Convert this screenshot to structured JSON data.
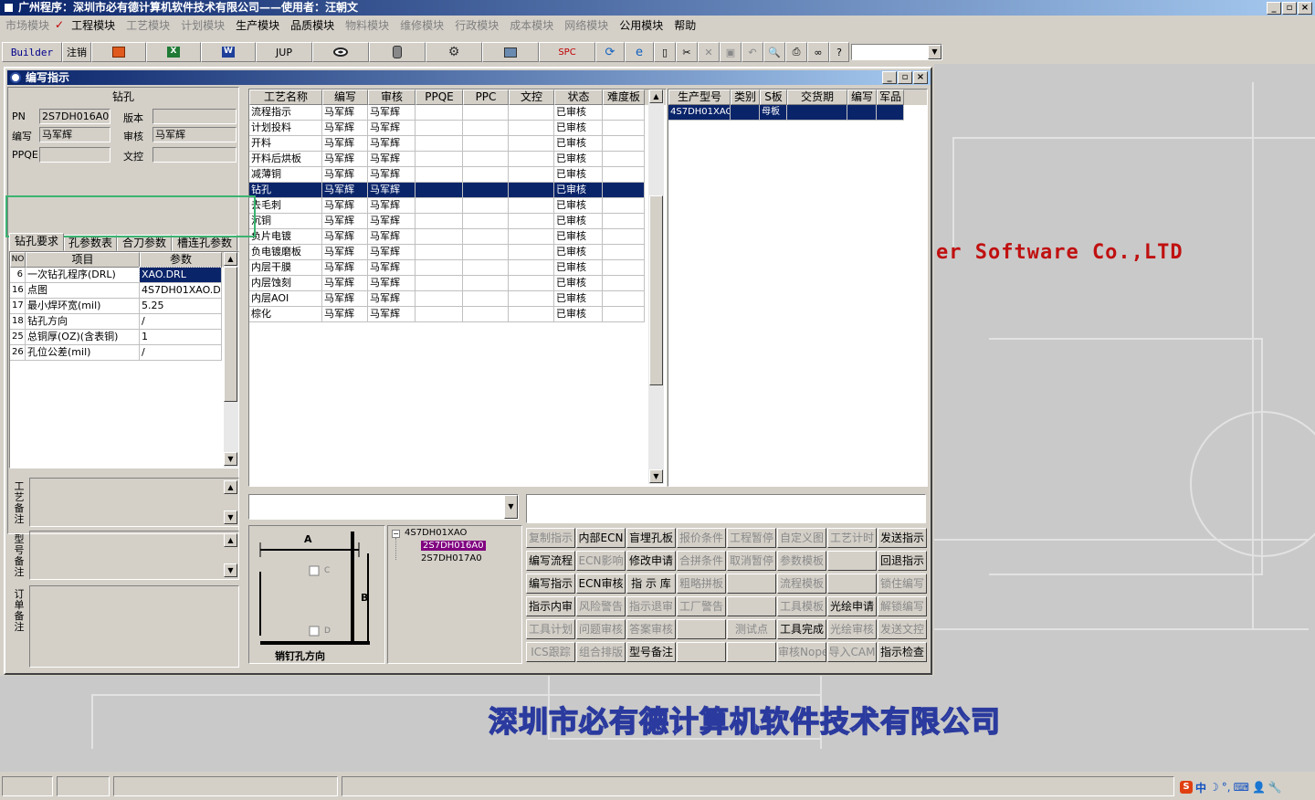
{
  "title": "广州程序：深圳市必有德计算机软件技术有限公司——使用者：汪朝文",
  "menu": [
    {
      "label": "市场模块",
      "enabled": false
    },
    {
      "label": "工程模块",
      "enabled": true
    },
    {
      "label": "工艺模块",
      "enabled": false
    },
    {
      "label": "计划模块",
      "enabled": false
    },
    {
      "label": "生产模块",
      "enabled": true
    },
    {
      "label": "品质模块",
      "enabled": true
    },
    {
      "label": "物料模块",
      "enabled": false
    },
    {
      "label": "维修模块",
      "enabled": false
    },
    {
      "label": "行政模块",
      "enabled": false
    },
    {
      "label": "成本模块",
      "enabled": false
    },
    {
      "label": "网络模块",
      "enabled": false
    },
    {
      "label": "公用模块",
      "enabled": true
    },
    {
      "label": "帮助",
      "enabled": true
    }
  ],
  "toolbar": {
    "builder": "Builder",
    "logout": "注销",
    "jup": "JUP",
    "spc": "SPC"
  },
  "child_title": "编写指示",
  "left": {
    "section_title": "钻孔",
    "pn_label": "PN",
    "pn_value": "2S7DH016A0",
    "version_label": "版本",
    "version_value": "",
    "author_label": "编写",
    "author_value": "马军辉",
    "reviewer_label": "审核",
    "reviewer_value": "马军辉",
    "ppqe_label": "PPQE",
    "ppqe_value": "",
    "control_label": "文控",
    "control_value": "",
    "tabs": [
      "钻孔要求",
      "孔参数表",
      "合刀参数",
      "槽连孔参数"
    ],
    "param_headers": [
      "NO",
      "项目",
      "参数"
    ],
    "params": [
      {
        "no": "6",
        "item": "一次钻孔程序(DRL)",
        "value": "XAO.DRL"
      },
      {
        "no": "16",
        "item": "点图",
        "value": "4S7DH01XAO.D"
      },
      {
        "no": "17",
        "item": "最小焊环宽(mil)",
        "value": "5.25"
      },
      {
        "no": "18",
        "item": "钻孔方向",
        "value": "/"
      },
      {
        "no": "25",
        "item": "总铜厚(OZ)(含表铜)",
        "value": "1"
      },
      {
        "no": "26",
        "item": "孔位公差(mil)",
        "value": "/"
      }
    ],
    "note_labels": [
      "工艺备注",
      "型号备注",
      "订单备注"
    ]
  },
  "process": {
    "headers": [
      "工艺名称",
      "编写",
      "审核",
      "PPQE",
      "PPC",
      "文控",
      "状态",
      "难度板"
    ],
    "rows": [
      [
        "流程指示",
        "马军辉",
        "马军辉",
        "",
        "",
        "",
        "已审核",
        ""
      ],
      [
        "计划投料",
        "马军辉",
        "马军辉",
        "",
        "",
        "",
        "已审核",
        ""
      ],
      [
        "开料",
        "马军辉",
        "马军辉",
        "",
        "",
        "",
        "已审核",
        ""
      ],
      [
        "开料后烘板",
        "马军辉",
        "马军辉",
        "",
        "",
        "",
        "已审核",
        ""
      ],
      [
        "减薄铜",
        "马军辉",
        "马军辉",
        "",
        "",
        "",
        "已审核",
        ""
      ],
      [
        "钻孔",
        "马军辉",
        "马军辉",
        "",
        "",
        "",
        "已审核",
        ""
      ],
      [
        "去毛刺",
        "马军辉",
        "马军辉",
        "",
        "",
        "",
        "已审核",
        ""
      ],
      [
        "沉铜",
        "马军辉",
        "马军辉",
        "",
        "",
        "",
        "已审核",
        ""
      ],
      [
        "负片电镀",
        "马军辉",
        "马军辉",
        "",
        "",
        "",
        "已审核",
        ""
      ],
      [
        "负电镀磨板",
        "马军辉",
        "马军辉",
        "",
        "",
        "",
        "已审核",
        ""
      ],
      [
        "内层干膜",
        "马军辉",
        "马军辉",
        "",
        "",
        "",
        "已审核",
        ""
      ],
      [
        "内层蚀刻",
        "马军辉",
        "马军辉",
        "",
        "",
        "",
        "已审核",
        ""
      ],
      [
        "内层AOI",
        "马军辉",
        "马军辉",
        "",
        "",
        "",
        "已审核",
        ""
      ],
      [
        "棕化",
        "马军辉",
        "马军辉",
        "",
        "",
        "",
        "已审核",
        ""
      ]
    ],
    "selected_index": 5
  },
  "product": {
    "headers": [
      "生产型号",
      "类别",
      "S板",
      "交货期",
      "编写",
      "军品"
    ],
    "rows": [
      [
        "4S7DH01XAO",
        "",
        "母板",
        "",
        "",
        ""
      ]
    ]
  },
  "tree": {
    "root": "4S7DH01XAO",
    "children": [
      "2S7DH016A0",
      "2S7DH017A0"
    ]
  },
  "pin_diagram": {
    "a": "A",
    "b": "B",
    "c": "C",
    "d": "D",
    "caption": "销钉孔方向"
  },
  "actions": [
    [
      {
        "label": "复制指示",
        "enabled": false
      },
      {
        "label": "内部ECN",
        "enabled": true
      },
      {
        "label": "盲埋孔板",
        "enabled": true
      },
      {
        "label": "报价条件",
        "enabled": false
      },
      {
        "label": "工程暂停",
        "enabled": false
      },
      {
        "label": "自定义图",
        "enabled": false
      },
      {
        "label": "工艺计时",
        "enabled": false
      },
      {
        "label": "发送指示",
        "enabled": true
      }
    ],
    [
      {
        "label": "编写流程",
        "enabled": true
      },
      {
        "label": "ECN影响",
        "enabled": false
      },
      {
        "label": "修改申请",
        "enabled": true
      },
      {
        "label": "合拼条件",
        "enabled": false
      },
      {
        "label": "取消暂停",
        "enabled": false
      },
      {
        "label": "参数模板",
        "enabled": false
      },
      {
        "label": "",
        "enabled": false
      },
      {
        "label": "回退指示",
        "enabled": true
      }
    ],
    [
      {
        "label": "编写指示",
        "enabled": true
      },
      {
        "label": "ECN审核",
        "enabled": true
      },
      {
        "label": "指 示 库",
        "enabled": true
      },
      {
        "label": "粗略拼板",
        "enabled": false
      },
      {
        "label": "",
        "enabled": false
      },
      {
        "label": "流程模板",
        "enabled": false
      },
      {
        "label": "",
        "enabled": false
      },
      {
        "label": "锁住编写",
        "enabled": false
      }
    ],
    [
      {
        "label": "指示内审",
        "enabled": true
      },
      {
        "label": "风险警告",
        "enabled": false
      },
      {
        "label": "指示退审",
        "enabled": false
      },
      {
        "label": "工厂警告",
        "enabled": false
      },
      {
        "label": "",
        "enabled": false
      },
      {
        "label": "工具模板",
        "enabled": false
      },
      {
        "label": "光绘申请",
        "enabled": true
      },
      {
        "label": "解锁编写",
        "enabled": false
      }
    ],
    [
      {
        "label": "工具计划",
        "enabled": false
      },
      {
        "label": "问题审核",
        "enabled": false
      },
      {
        "label": "答案审核",
        "enabled": false
      },
      {
        "label": "",
        "enabled": false
      },
      {
        "label": "测试点",
        "enabled": false
      },
      {
        "label": "工具完成",
        "enabled": true
      },
      {
        "label": "光绘审核",
        "enabled": false
      },
      {
        "label": "发送文控",
        "enabled": false
      }
    ],
    [
      {
        "label": "ICS跟踪",
        "enabled": false
      },
      {
        "label": "组合排版",
        "enabled": false
      },
      {
        "label": "型号备注",
        "enabled": true
      },
      {
        "label": "",
        "enabled": false
      },
      {
        "label": "",
        "enabled": false
      },
      {
        "label": "审核Nope",
        "enabled": false
      },
      {
        "label": "导入CAM",
        "enabled": false
      },
      {
        "label": "指示检查",
        "enabled": true
      }
    ]
  ],
  "branding": {
    "en": "er Software Co.,LTD",
    "cn": "深圳市必有德计算机软件技术有限公司"
  },
  "tray": {
    "ime": "中"
  }
}
